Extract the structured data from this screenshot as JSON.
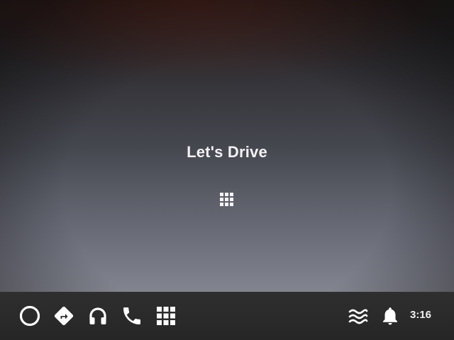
{
  "main": {
    "title": "Let's Drive",
    "launcher_icon": "app-grid-icon"
  },
  "bottom_bar": {
    "left_icons": [
      "home-circle-icon",
      "navigation-icon",
      "headphones-icon",
      "phone-icon",
      "app-grid-icon"
    ],
    "right_icons": [
      "hvac-icon",
      "notification-bell-icon"
    ],
    "clock": "3:16"
  },
  "colors": {
    "text": "#f2f2f4",
    "bar": "#2b2b2b",
    "background_top": "#242222",
    "background_bottom": "#82848f"
  }
}
